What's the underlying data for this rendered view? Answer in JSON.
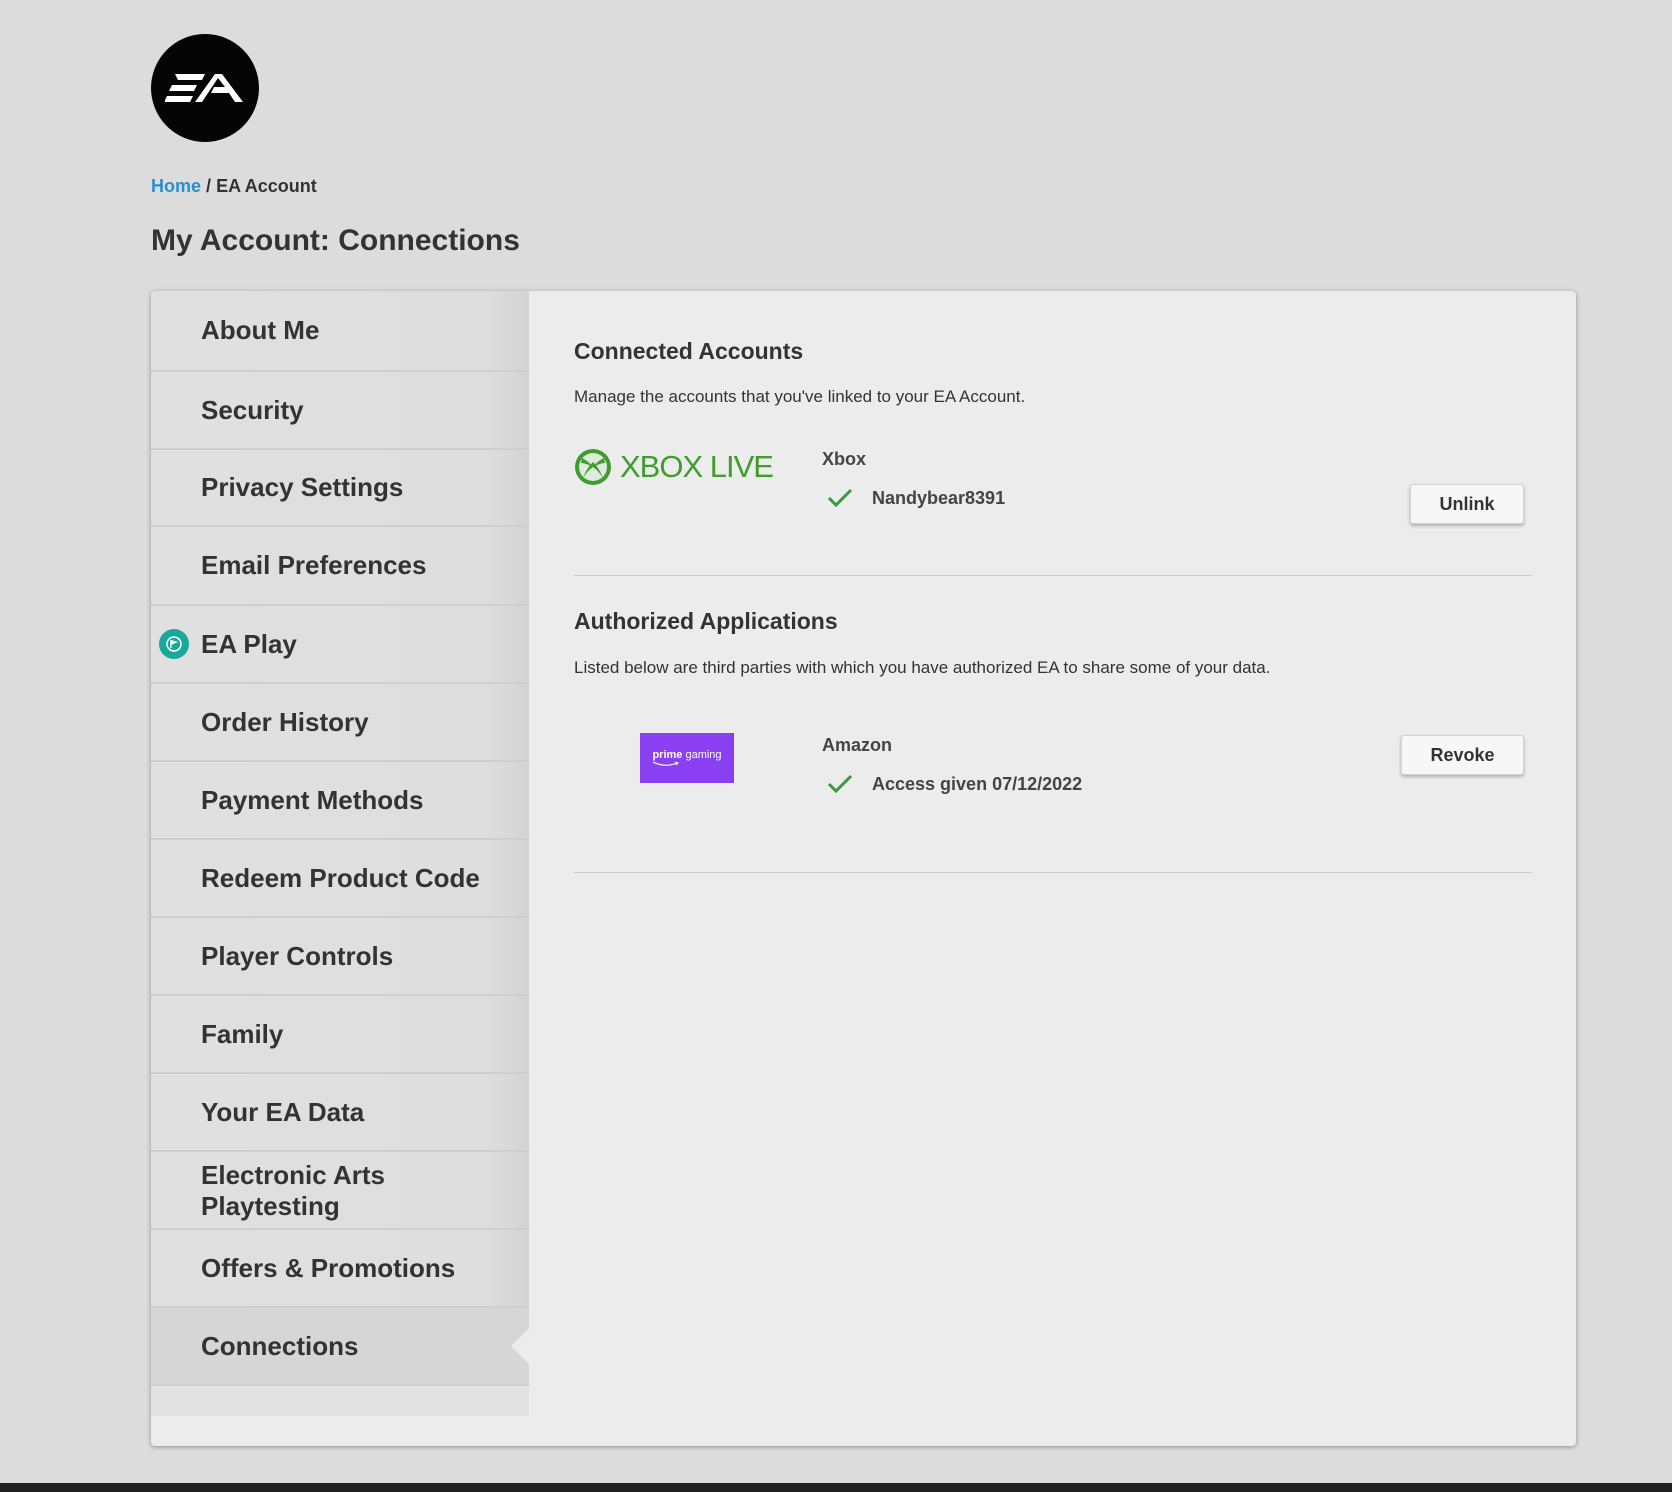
{
  "breadcrumb": {
    "home": "Home",
    "separator": "/",
    "current": "EA Account"
  },
  "page_title": "My Account: Connections",
  "sidebar": {
    "items": [
      {
        "label": "About Me"
      },
      {
        "label": "Security"
      },
      {
        "label": "Privacy Settings"
      },
      {
        "label": "Email Preferences"
      },
      {
        "label": "EA Play",
        "icon": "ea-play-icon"
      },
      {
        "label": "Order History"
      },
      {
        "label": "Payment Methods"
      },
      {
        "label": "Redeem Product Code"
      },
      {
        "label": "Player Controls"
      },
      {
        "label": "Family"
      },
      {
        "label": "Your EA Data"
      },
      {
        "label": "Electronic Arts Playtesting"
      },
      {
        "label": "Offers & Promotions"
      },
      {
        "label": "Connections",
        "active": true
      }
    ]
  },
  "connected_accounts": {
    "title": "Connected Accounts",
    "description": "Manage the accounts that you've linked to your EA Account.",
    "logo_text": "XBOX LIVE",
    "service": "Xbox",
    "username": "Nandybear8391",
    "button": "Unlink"
  },
  "authorized_apps": {
    "title": "Authorized Applications",
    "description": "Listed below are third parties with which you have authorized EA to share some of your data.",
    "logo_prime": "prime",
    "logo_gaming": "gaming",
    "service": "Amazon",
    "access_text": "Access given 07/12/2022",
    "button": "Revoke"
  },
  "colors": {
    "link": "#2a8fd0",
    "check": "#3a9a3a",
    "xbox_green": "#3e9d2d",
    "prime_purple": "#8a3ff2",
    "ea_play_teal": "#1aa89a"
  }
}
